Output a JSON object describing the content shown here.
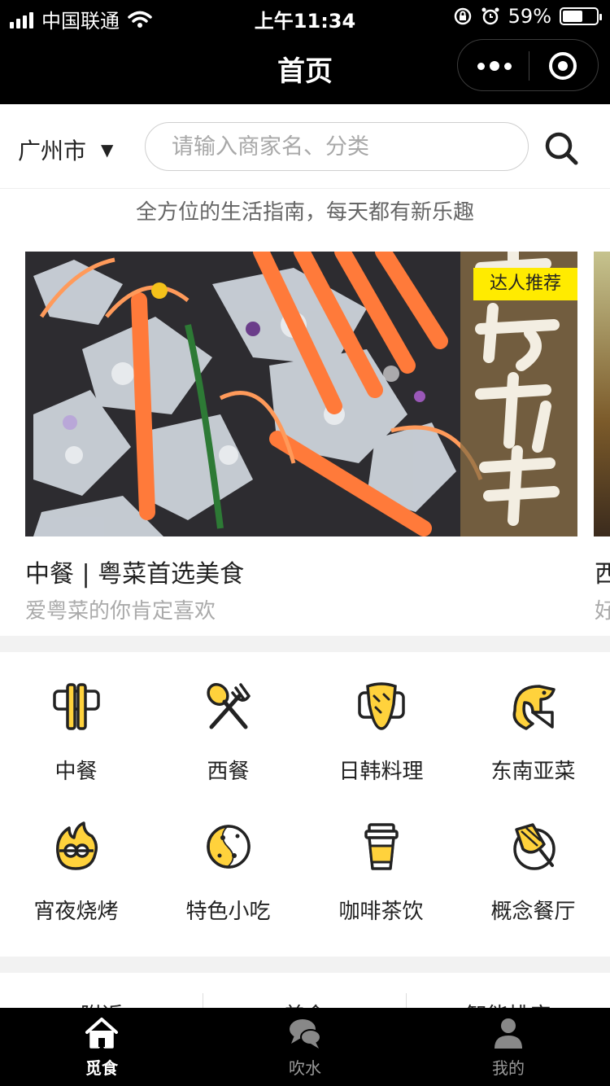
{
  "status": {
    "carrier": "中国联通",
    "time": "上午11:34",
    "battery": "59%",
    "battery_level": 0.59
  },
  "nav": {
    "title": "首页"
  },
  "search": {
    "city": "广州市",
    "placeholder": "请输入商家名、分类"
  },
  "tagline": "全方位的生活指南，每天都有新乐趣",
  "banner": {
    "badge": "达人推荐",
    "art_text": "鲜活刺身",
    "title": "中餐 | 粤菜首选美食",
    "subtitle": "爱粤菜的你肯定喜欢",
    "next_title": "西",
    "next_subtitle": "好"
  },
  "categories": [
    {
      "label": "中餐",
      "icon": "chopsticks-icon"
    },
    {
      "label": "西餐",
      "icon": "spoon-fork-icon"
    },
    {
      "label": "日韩料理",
      "icon": "sushi-icon"
    },
    {
      "label": "东南亚菜",
      "icon": "shrimp-icon"
    },
    {
      "label": "宵夜烧烤",
      "icon": "bbq-icon"
    },
    {
      "label": "特色小吃",
      "icon": "snack-plate-icon"
    },
    {
      "label": "咖啡茶饮",
      "icon": "coffee-cup-icon"
    },
    {
      "label": "概念餐厅",
      "icon": "concept-plate-icon"
    }
  ],
  "sort_tabs": [
    "附近",
    "美食",
    "智能排序"
  ],
  "tabbar": [
    {
      "label": "觅食",
      "icon": "home-icon",
      "active": true
    },
    {
      "label": "吹水",
      "icon": "chat-icon",
      "active": false
    },
    {
      "label": "我的",
      "icon": "profile-icon",
      "active": false
    }
  ],
  "colors": {
    "accent_yellow": "#ffd23c",
    "badge_yellow": "#ffeb00",
    "bar": "#000000"
  }
}
